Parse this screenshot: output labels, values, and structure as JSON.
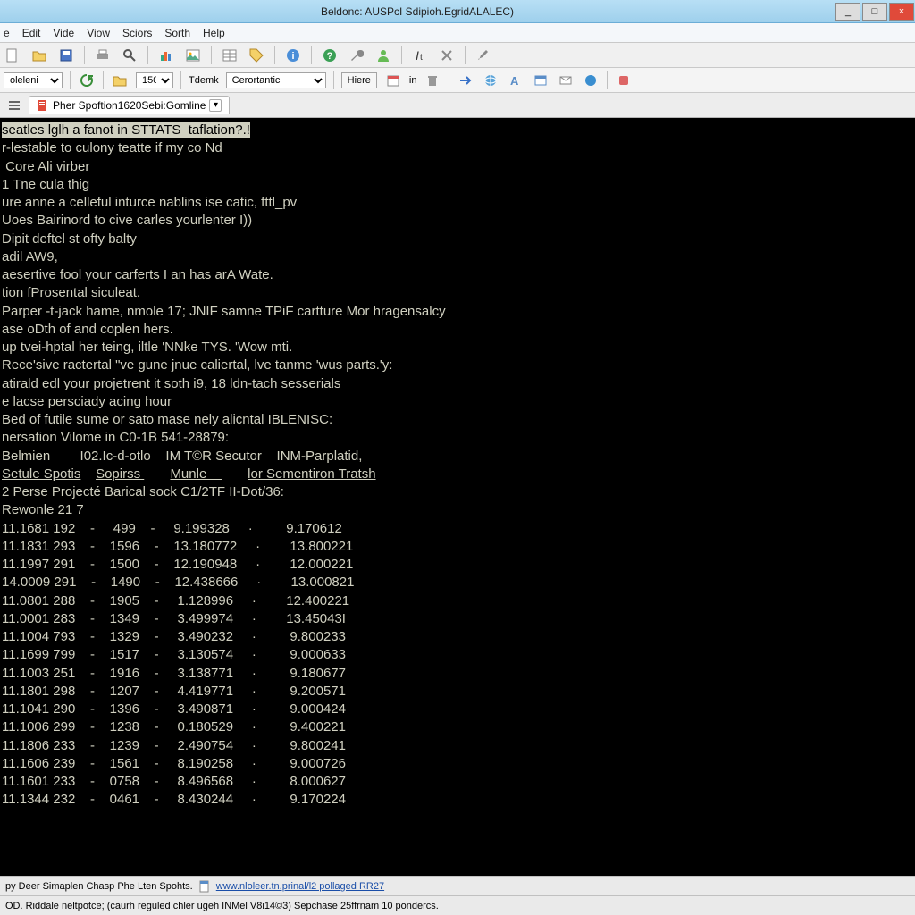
{
  "titlebar": {
    "text": "Beldonc: AUSPcI Sdipioh.EgridALALEC)"
  },
  "menu": {
    "items": [
      "e",
      "Edit",
      "Vide",
      "Viow",
      "Sciors",
      "Sorth",
      "Help"
    ]
  },
  "toolbar2": {
    "sel1": "oleleni",
    "num": "150",
    "lbl": "Tdemk",
    "sel2": "Cerortantic",
    "btn": "Hiere",
    "lbl2": "in"
  },
  "tab": {
    "label": "Pher Spoftion1620Sebi:Gomline"
  },
  "terminal": {
    "lines": [
      "seatles lglh a fanot in STTATS  taflation?.!",
      "r-lestable to culony teatte if my co Nd",
      " Core Ali virber",
      "1 Tne cula thig",
      "ure anne a celleful inturce nablins ise catic, fttl_pv",
      "Uoes Bairinord to cive carles yourlenter I))",
      "Dipit deftel st ofty balty",
      "",
      "adil AW9,",
      "",
      "aesertive fool your carferts I an has arA Wate.",
      "",
      "tion fProsental siculeat.",
      "Parper -t-jack hame, nmole 17; JNIF samne TPiF cartture Mor hragensalcy",
      "ase oDth of and coplen hers.",
      "up tvei-hptal her teing, iltle 'NNke TYS. 'Wow mti.",
      "Rece'sive ractertal \"ve gune jnue caliertal, lve tanme 'wus parts.'y:",
      "atirald edl your projetrent it soth i9, 18 ldn-tach sesserials",
      "e lacse persciady acing hour",
      "Bed of futile sume or sato mase nely alicntal IBLENISC:",
      "",
      "nersation Vilome in C0-1B 541-28879:",
      "",
      "Belmien        I02.Ic-d-otlo    IM T©R Secutor    INM-Parplatid,",
      "Setule Spotis    Sopirss        Munle           lor Sementiron Tratsh",
      "",
      "2 Perse Projecté Barical sock C1/2TF II-Dot/36:",
      "Rewonle 21 7",
      "11.1681 192    -     499    -     9.199328     ·         9.170612",
      "11.1831 293    -    1596    -    13.180772     ·        13.800221",
      "11.1997 291    -    1500    -    12.190948     ·        12.000221",
      "14.0009 291    -    1490    -    12.438666     ·        13.000821",
      "11.0801 288    -    1905    -     1.128996     ·        12.400221",
      "11.0001 283    -    1349    -     3.499974     ·        13.45043I",
      "11.1004 793    -    1329    -     3.490232     ·         9.800233",
      "11.1699 799    -    1517    -     3.130574     ·         9.000633",
      "11.1003 251    -    1916    -     3.138771     ·         9.180677",
      "11.1801 298    -    1207    -     4.419771     ·         9.200571",
      "11.1041 290    -    1396    -     3.490871     ·         9.000424",
      "11.1006 299    -    1238    -     0.180529     ·         9.400221",
      "11.1806 233    -    1239    -     2.490754     ·         9.800241",
      "11.1606 239    -    1561    -     8.190258     ·         9.000726",
      "11.1601 233    -    0758    -     8.496568     ·         8.000627",
      "11.1344 232    -    0461    -     8.430244     ·         9.170224"
    ]
  },
  "status1": {
    "text": "py Deer Simaplen Chasp Phe Lten Spohts.",
    "link": "www.nloleer.tn.prinal/l2 pollaged RR27"
  },
  "status2": {
    "text": "OD. Riddale neltpotce; (caurh reguled chler ugeh INMel V8i14©3) Sepchase 25ffrnam 10 pondercs."
  },
  "colors": {
    "titlebar": "#a7d6ef",
    "terminal_bg": "#000000",
    "terminal_fg": "#d0d0c0"
  }
}
